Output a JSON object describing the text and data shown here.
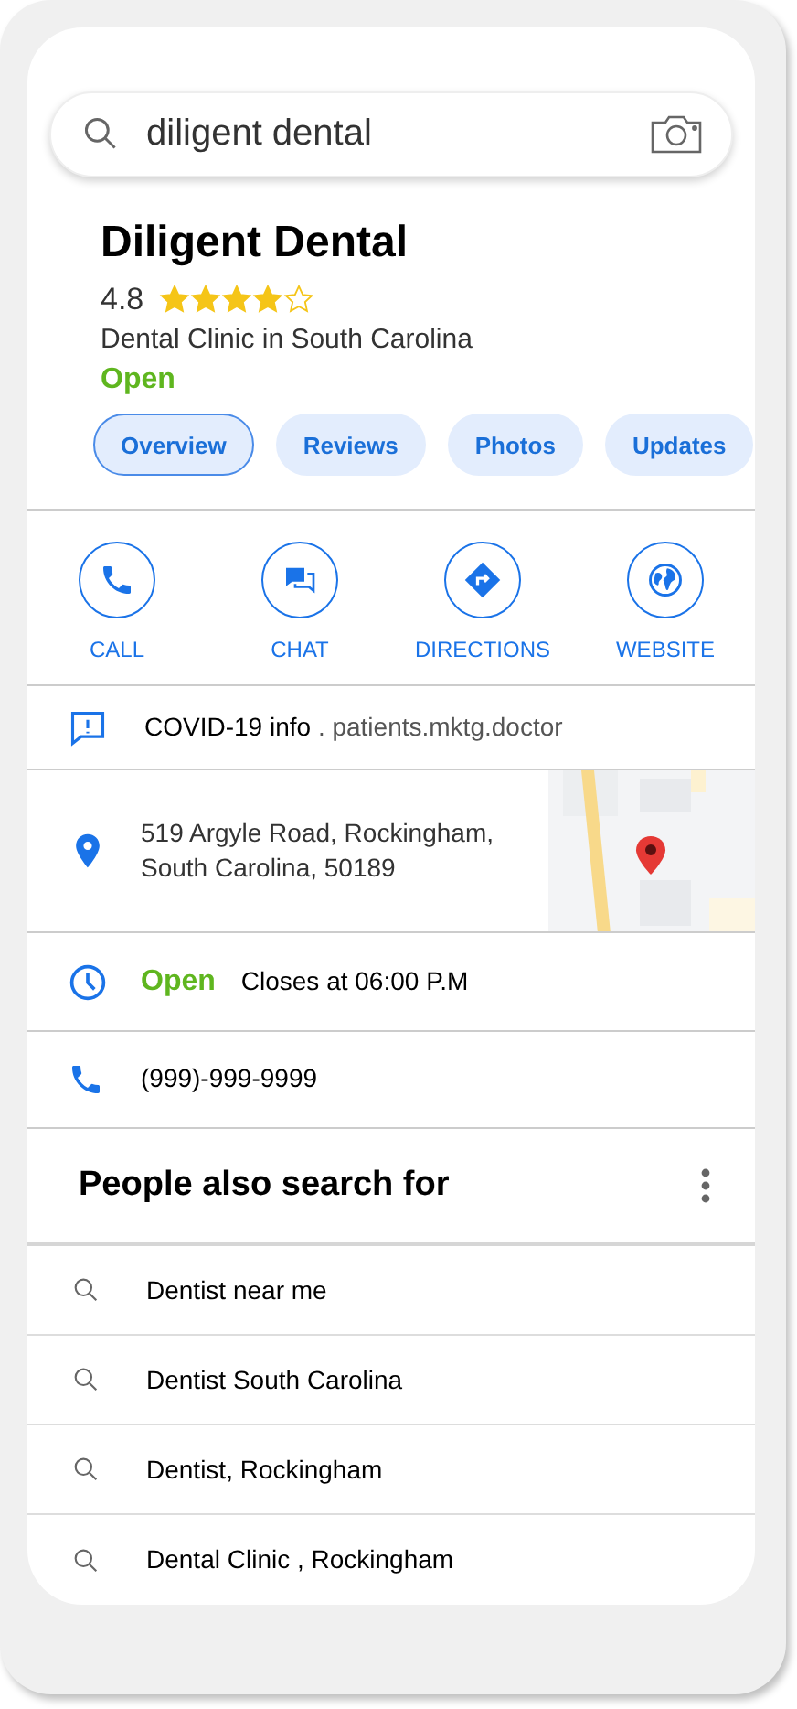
{
  "search": {
    "value": "diligent dental"
  },
  "place": {
    "name": "Diligent Dental",
    "rating": "4.8",
    "stars": 4,
    "category": "Dental Clinic in South Carolina",
    "status": "Open"
  },
  "tabs": [
    {
      "label": "Overview",
      "selected": true
    },
    {
      "label": "Reviews",
      "selected": false
    },
    {
      "label": "Photos",
      "selected": false
    },
    {
      "label": "Updates",
      "selected": false
    }
  ],
  "actions": [
    {
      "kind": "call",
      "label": "CALL"
    },
    {
      "kind": "chat",
      "label": "CHAT"
    },
    {
      "kind": "directions",
      "label": "DIRECTIONS"
    },
    {
      "kind": "website",
      "label": "WEBSITE"
    }
  ],
  "info": {
    "covid_label": "COVID-19 info",
    "covid_link": ". patients.mktg.doctor",
    "address_line_1": "519 Argyle Road, Rockingham,",
    "address_line_2": "South Carolina, 50189",
    "hours_status": "Open",
    "hours_text": "Closes at 06:00 P.M",
    "phone": "(999)-999-9999"
  },
  "related": {
    "title": "People also search for",
    "items": [
      "Dentist near me",
      "Dentist South Carolina",
      "Dentist, Rockingham",
      "Dental Clinic , Rockingham"
    ]
  }
}
